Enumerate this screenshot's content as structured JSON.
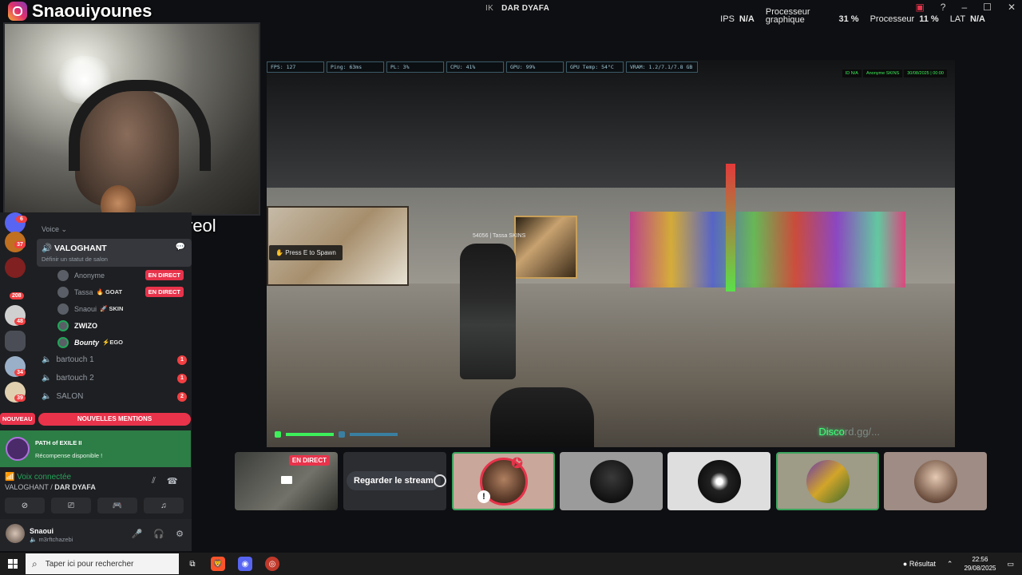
{
  "stream_overlay": {
    "instagram_handle": "Snaouiyounes",
    "tiktok_handle": "Arreol"
  },
  "window": {
    "title": "DAR DYAFA",
    "title_prefix": "IK"
  },
  "perf_overlay": {
    "ips_label": "IPS",
    "ips_value": "N/A",
    "gpu_label_1": "Processeur",
    "gpu_label_2": "graphique",
    "gpu_value": "31 %",
    "cpu_label": "Processeur",
    "cpu_value": "11 %",
    "lat_label": "LAT",
    "lat_value": "N/A"
  },
  "game_hud": {
    "fps": "FPS: 127",
    "ping": "Ping: 63ms",
    "pl": "PL: 3%",
    "cpu": "CPU: 41%",
    "gpu": "GPU: 99%",
    "gpu_temp": "GPU Temp: 54°C",
    "vram": "VRAM: 1.2/7.1/7.8 GB",
    "id_label": "ID N/A",
    "server_tag": "Anonyme SKINS",
    "datetime": "30/08/2025 | 00:00",
    "press_hint": "Press E to Spawn",
    "player_tag": "54056 | Tassa SKINS",
    "disco_text": "Disco",
    "disco_faded": "rd.gg/..."
  },
  "stream_tiles": {
    "live_badge": "EN DIRECT",
    "watch_button": "Regarder le stream"
  },
  "guild_badges": [
    "6",
    "37",
    "208",
    "48",
    "34",
    "39"
  ],
  "nouveau_label": "NOUVEAU",
  "voice_section_label": "Voice",
  "active_channel": {
    "name": "VALOGHANT",
    "status": "Définir un statut de salon"
  },
  "members": [
    {
      "name": "Anonyme",
      "tag": "",
      "live": "EN DIRECT"
    },
    {
      "name": "Tassa",
      "tag": "🔥 GOAT",
      "live": "EN DIRECT"
    },
    {
      "name": "Snaoui",
      "tag": "🚀 SKIN",
      "live": ""
    },
    {
      "name": "ZWIZO",
      "tag": "",
      "live": ""
    },
    {
      "name": "Bounty",
      "tag": "⚡EGO",
      "live": ""
    }
  ],
  "voice_channels": [
    {
      "name": "bartouch 1",
      "count": "1"
    },
    {
      "name": "bartouch 2",
      "count": "1"
    },
    {
      "name": "SALON",
      "count": "2"
    }
  ],
  "mentions_label": "NOUVELLES MENTIONS",
  "reward": {
    "title": "PATH of EXILE II",
    "text": "Récompense disponible !"
  },
  "voice_connection": {
    "status": "Voix connectée",
    "channel": "VALOGHANT",
    "server": "DAR DYAFA"
  },
  "user": {
    "name": "Snaoui",
    "status": "m3rftchazebi"
  },
  "taskbar": {
    "search_placeholder": "Taper ici pour rechercher",
    "widget_label": "Résultat",
    "time": "22:56",
    "date": "29/08/2025"
  }
}
